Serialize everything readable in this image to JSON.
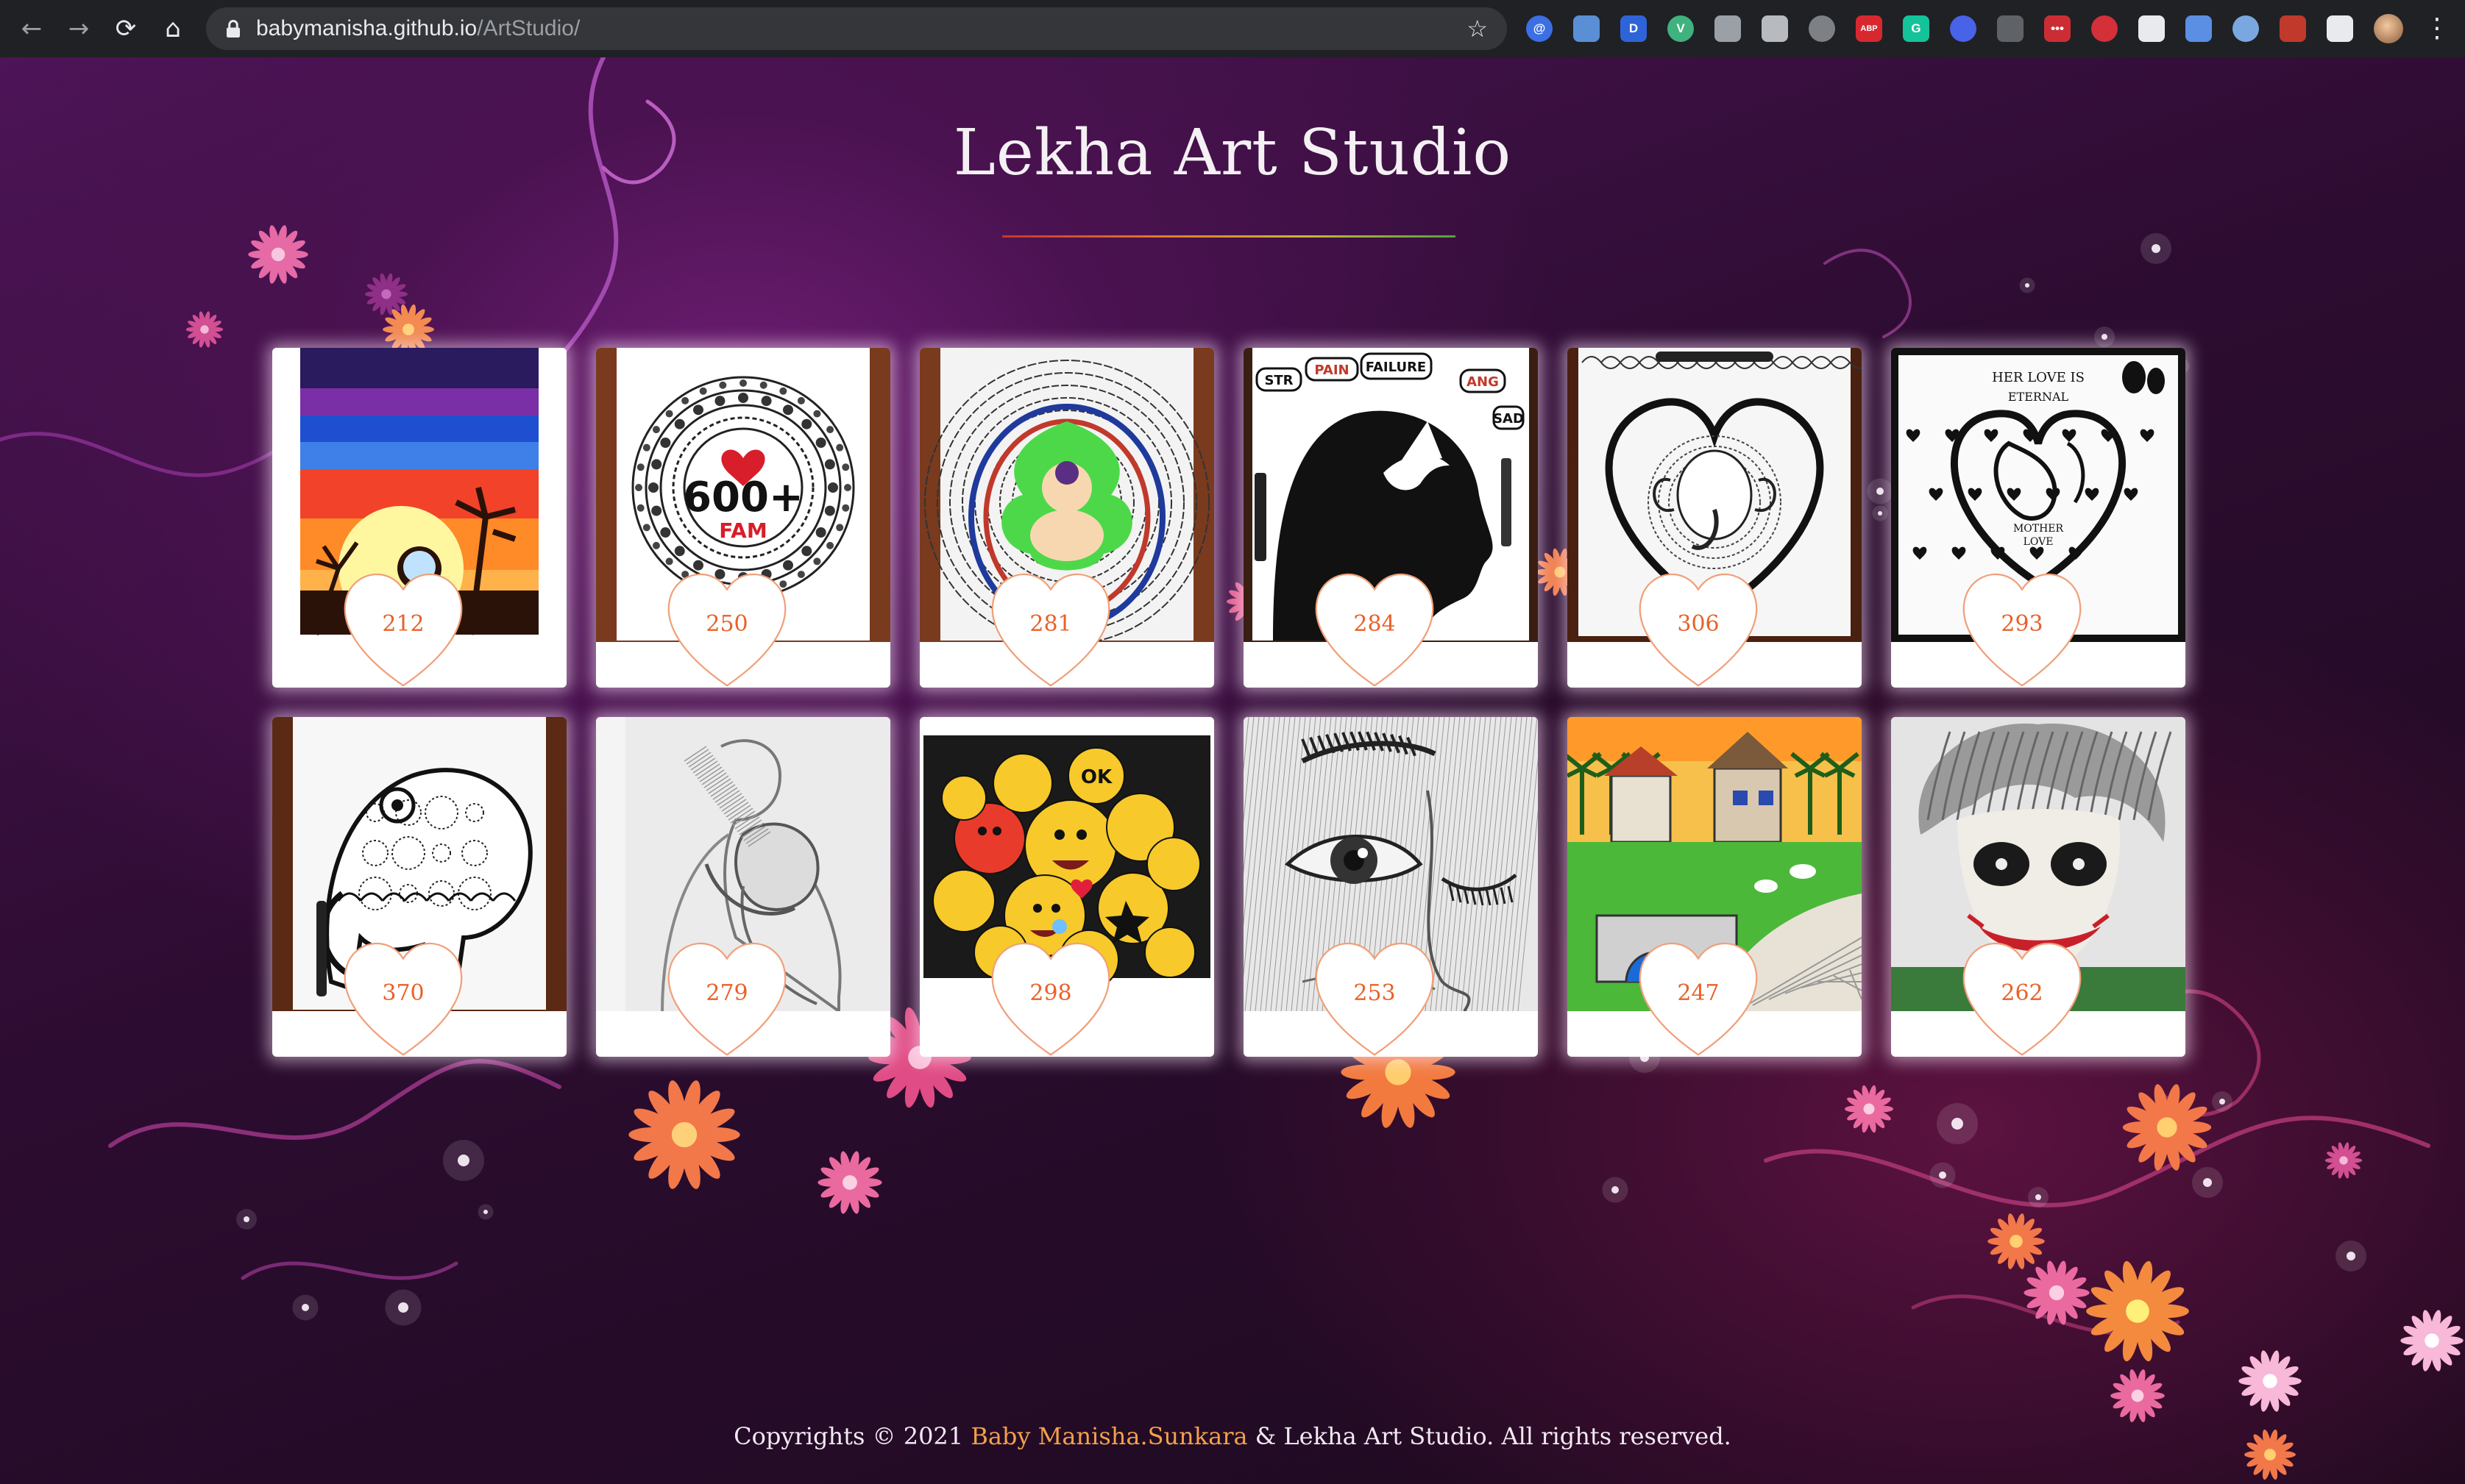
{
  "browser": {
    "url_host": "babymanisha.github.io",
    "url_path": "/ArtStudio/",
    "extensions": [
      {
        "name": "at-extension-icon",
        "glyph": "@",
        "color": "#3b6fe3"
      },
      {
        "name": "page-extension-icon",
        "glyph": "",
        "color": "#5a8fd6"
      },
      {
        "name": "d-extension-icon",
        "glyph": "D",
        "color": "#2f64d8"
      },
      {
        "name": "vue-devtools-icon",
        "glyph": "V",
        "color": "#3fb27f"
      },
      {
        "name": "gear-extension-icon",
        "glyph": "",
        "color": "#9aa0a6"
      },
      {
        "name": "pocket-icon",
        "glyph": "",
        "color": "#b7bbc0"
      },
      {
        "name": "inbox-extension-icon",
        "glyph": "",
        "color": "#7d8186"
      },
      {
        "name": "adblock-plus-icon",
        "glyph": "ABP",
        "color": "#d7282f"
      },
      {
        "name": "grammarly-icon",
        "glyph": "G",
        "color": "#15c39a"
      },
      {
        "name": "link-extension-icon",
        "glyph": "",
        "color": "#4862e8"
      },
      {
        "name": "github-icon",
        "glyph": "",
        "color": "#5f6368"
      },
      {
        "name": "lastpass-icon",
        "glyph": "•••",
        "color": "#cc2d35"
      },
      {
        "name": "block-icon",
        "glyph": "",
        "color": "#d3303a"
      },
      {
        "name": "qr-code-icon",
        "glyph": "",
        "color": "#e8eaed"
      },
      {
        "name": "pen-extension-icon",
        "glyph": "",
        "color": "#5a8fe3"
      },
      {
        "name": "screenshot-extension-icon",
        "glyph": "",
        "color": "#7aa7e0"
      },
      {
        "name": "color-picker-icon",
        "glyph": "",
        "color": "#c0392b"
      },
      {
        "name": "puzzle-extensions-icon",
        "glyph": "",
        "color": "#e8eaed"
      }
    ]
  },
  "site": {
    "title": "Lekha Art Studio"
  },
  "gallery": [
    {
      "art": "sunset",
      "likes": "212"
    },
    {
      "art": "mandala-600",
      "likes": "250"
    },
    {
      "art": "buddha-mandala",
      "likes": "281"
    },
    {
      "art": "silhouette-dove",
      "likes": "284"
    },
    {
      "art": "ganesha-heart",
      "likes": "306"
    },
    {
      "art": "mother-love",
      "likes": "293"
    },
    {
      "art": "zentangle-elephant",
      "likes": "370"
    },
    {
      "art": "embrace-sketch",
      "likes": "279"
    },
    {
      "art": "emoji-collage",
      "likes": "298"
    },
    {
      "art": "eye-sketch",
      "likes": "253"
    },
    {
      "art": "village-landscape",
      "likes": "247"
    },
    {
      "art": "joker-portrait",
      "likes": "262"
    }
  ],
  "footer": {
    "prefix": "Copyrights © 2021",
    "author": "Baby Manisha.Sunkara",
    "suffix": "& Lekha Art Studio. All rights reserved."
  }
}
